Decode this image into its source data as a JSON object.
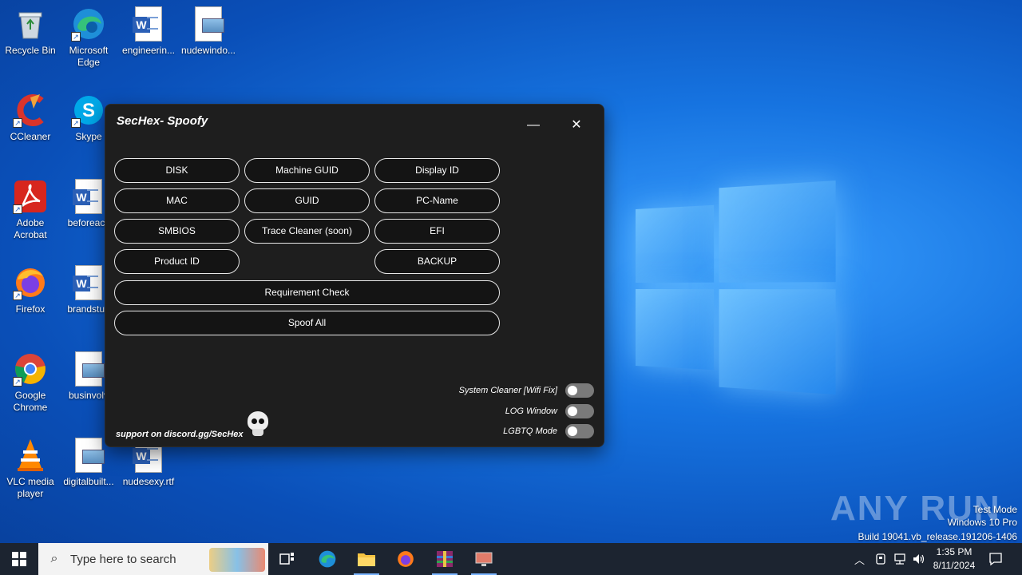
{
  "desktop": {
    "icons": [
      {
        "label": "Recycle Bin"
      },
      {
        "label": "Microsoft Edge"
      },
      {
        "label": "engineerin..."
      },
      {
        "label": "nudewindo..."
      },
      {
        "label": "CCleaner"
      },
      {
        "label": "Skype"
      },
      {
        "label": "Adobe Acrobat"
      },
      {
        "label": "beforeacc"
      },
      {
        "label": "Firefox"
      },
      {
        "label": "brandstud"
      },
      {
        "label": "Google Chrome"
      },
      {
        "label": "businvolv"
      },
      {
        "label": "VLC media player"
      },
      {
        "label": "digitalbuilt..."
      },
      {
        "label": "nudesexy.rtf"
      }
    ]
  },
  "app": {
    "title": "SecHex- Spoofy",
    "minimize_glyph": "—",
    "close_glyph": "✕",
    "buttons": {
      "disk": "DISK",
      "machine_guid": "Machine GUID",
      "display_id": "Display ID",
      "mac": "MAC",
      "guid": "GUID",
      "pc_name": "PC-Name",
      "smbios": "SMBIOS",
      "trace_cleaner": "Trace Cleaner (soon)",
      "efi": "EFI",
      "product_id": "Product ID",
      "backup": "BACKUP",
      "requirement_check": "Requirement Check",
      "spoof_all": "Spoof All"
    },
    "toggles": [
      {
        "label": "System Cleaner [Wifi Fix]",
        "on": false
      },
      {
        "label": "LOG Window",
        "on": false
      },
      {
        "label": "LGBTQ Mode",
        "on": false
      }
    ],
    "support_text": "support on discord.gg/SecHex"
  },
  "watermark": {
    "brand": "ANY RUN",
    "line1": "Test Mode",
    "line2": "Windows 10 Pro",
    "line3": "Build 19041.vb_release.191206-1406"
  },
  "taskbar": {
    "search_placeholder": "Type here to search",
    "time": "1:35 PM",
    "date": "8/11/2024"
  }
}
